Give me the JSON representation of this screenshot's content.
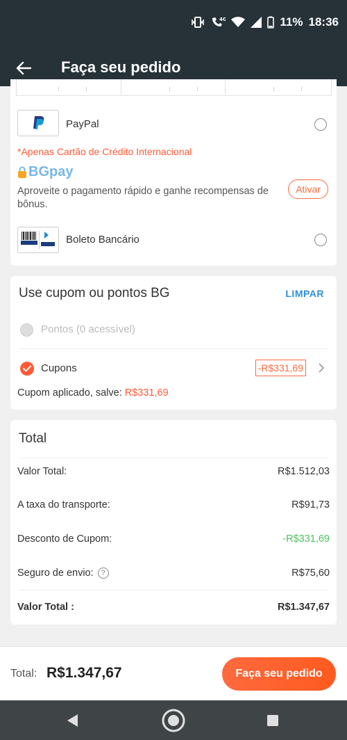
{
  "status_bar": {
    "battery_percent": "11%",
    "time": "18:36",
    "network_label": "4G",
    "icons": [
      "vibrate-icon",
      "call-icon",
      "wifi-icon",
      "signal-icon",
      "battery-icon"
    ]
  },
  "app_bar": {
    "title": "Faça seu pedido",
    "back_icon": "back-arrow-icon"
  },
  "payment": {
    "paypal": {
      "name": "PayPal",
      "selected": false
    },
    "warning": "*Apenas Cartão de Crédito  Internacional",
    "bgpay": {
      "logo_text": "BGpay",
      "description": "Aproveite o pagamento rápido e ganhe recompensas de bônus.",
      "activate_label": "Ativar"
    },
    "boleto": {
      "name": "Boleto Bancário",
      "selected": false
    }
  },
  "coupon": {
    "title": "Use cupom ou pontos BG",
    "clear_label": "LIMPAR",
    "points_label": "Pontos (0 acessível)",
    "coupons_label": "Cupons",
    "coupons_value": "-R$331,69",
    "applied_text": "Cupom aplicado, salve:",
    "applied_amount": "R$331,69"
  },
  "totals": {
    "title": "Total",
    "rows": [
      {
        "label": "Valor Total:",
        "value": "R$1.512,03"
      },
      {
        "label": "A taxa do transporte:",
        "value": "R$91,73"
      },
      {
        "label": "Desconto de Cupom:",
        "value": "-R$331,69"
      },
      {
        "label": "Seguro de envio:",
        "value": "R$75,60"
      },
      {
        "label": "Valor Total :",
        "value": "R$1.347,67"
      }
    ]
  },
  "bottom_bar": {
    "total_label": "Total:",
    "total_amount": "R$1.347,67",
    "order_button": "Faça seu pedido"
  },
  "colors": {
    "header": "#263238",
    "accent": "#ff5a36",
    "link": "#2f8fd8",
    "discount": "#4cc25d"
  }
}
